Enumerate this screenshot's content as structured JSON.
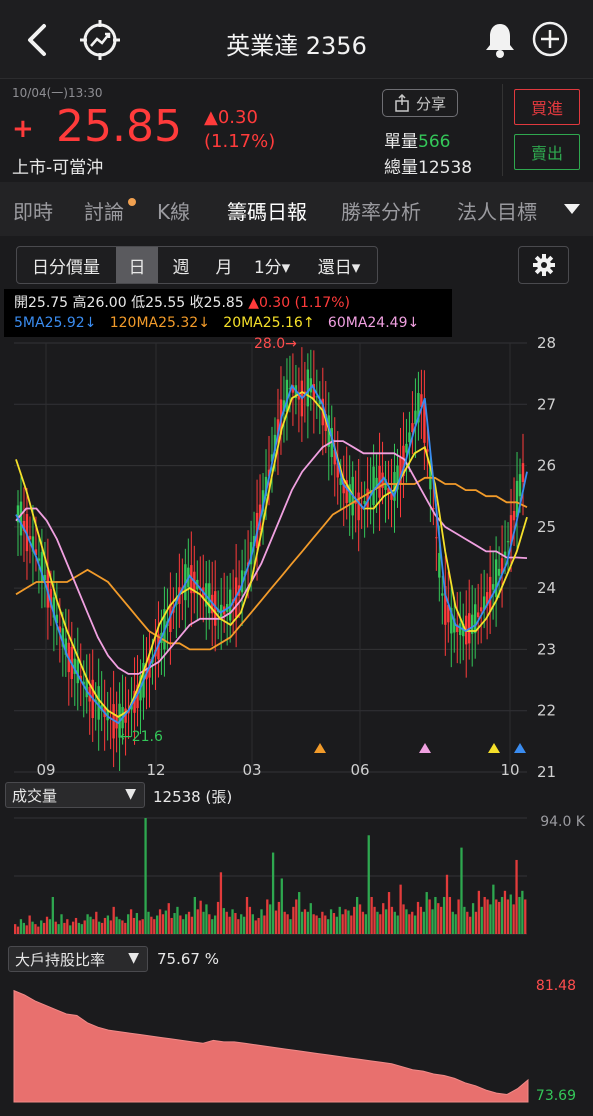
{
  "header": {
    "title": "英業達 2356",
    "back_icon": "chevron-left-icon",
    "logo_icon": "trend-target-icon",
    "bell_icon": "bell-icon",
    "add_icon": "plus-circle-icon"
  },
  "quote": {
    "datetime": "10/04(一)13:30",
    "sign": "+",
    "price": "25.85",
    "change": "▲0.30",
    "change_pct": "(1.17%)",
    "market": "上市-可當沖",
    "share_label": "分享",
    "unit_volume_label": "單量",
    "unit_volume": "566",
    "total_volume_label": "總量",
    "total_volume": "12538",
    "buy_label": "買進",
    "sell_label": "賣出",
    "up_color": "#ff3b3b",
    "down_color": "#34c759"
  },
  "tabs": [
    {
      "label": "即時"
    },
    {
      "label": "討論"
    },
    {
      "label": "K線"
    },
    {
      "label": "籌碼日報"
    },
    {
      "label": "勝率分析"
    },
    {
      "label": "法人目標"
    }
  ],
  "selector": {
    "items": [
      "日分價量",
      "日",
      "週",
      "月",
      "1分▾",
      "還日▾"
    ],
    "selected_index": 1
  },
  "info": {
    "open_label": "開",
    "open": "25.75",
    "high_label": "高",
    "high": "26.00",
    "low_label": "低",
    "low": "25.55",
    "close_label": "收",
    "close": "25.85",
    "change": "▲0.30 (1.17%)",
    "ma5": "5MA25.92↓",
    "ma120": "120MA25.32↓",
    "ma20": "20MA25.16↑",
    "ma60": "60MA24.49↓",
    "ma5_color": "#3a8cf0",
    "ma120_color": "#f29b2a",
    "ma20_color": "#f5e02a",
    "ma60_color": "#f0a0e0"
  },
  "chart_data": [
    {
      "type": "line",
      "title": "",
      "ylim": [
        21,
        28
      ],
      "y_ticks": [
        "28",
        "27",
        "26",
        "25",
        "24",
        "23",
        "22",
        "21"
      ],
      "x_ticks": [
        "09",
        "12",
        "03",
        "06",
        "10"
      ],
      "annotations": {
        "high": "28.0→",
        "low": "←21.6"
      },
      "series": [
        {
          "name": "5MA",
          "color": "#3a8cf0",
          "values": [
            25.2,
            24.9,
            24.5,
            24.0,
            23.4,
            22.9,
            22.6,
            22.3,
            22.1,
            21.9,
            21.8,
            22.0,
            22.3,
            22.7,
            23.1,
            23.5,
            23.9,
            24.2,
            24.0,
            23.8,
            23.6,
            23.7,
            24.0,
            24.5,
            25.2,
            26.0,
            26.8,
            27.3,
            27.1,
            27.3,
            27.0,
            26.4,
            25.7,
            25.5,
            25.3,
            25.6,
            25.8,
            25.5,
            26.0,
            26.6,
            27.1,
            25.5,
            23.9,
            23.4,
            23.3,
            23.4,
            23.7,
            24.0,
            24.4,
            25.1,
            25.9
          ]
        },
        {
          "name": "20MA",
          "color": "#f5e02a",
          "values": [
            26.1,
            25.6,
            25.0,
            24.4,
            23.8,
            23.3,
            22.9,
            22.5,
            22.2,
            22.0,
            21.9,
            22.0,
            22.4,
            22.9,
            23.4,
            23.7,
            23.9,
            24.0,
            23.9,
            23.7,
            23.5,
            23.4,
            23.6,
            24.1,
            24.9,
            25.8,
            26.6,
            27.1,
            27.2,
            27.1,
            26.9,
            26.4,
            25.8,
            25.5,
            25.3,
            25.3,
            25.5,
            25.6,
            25.9,
            26.2,
            26.3,
            25.7,
            24.6,
            23.7,
            23.3,
            23.3,
            23.5,
            23.8,
            24.2,
            24.6,
            25.16
          ]
        },
        {
          "name": "60MA",
          "color": "#f0a0e0",
          "values": [
            25.1,
            25.3,
            25.3,
            25.1,
            24.8,
            24.4,
            24.0,
            23.6,
            23.2,
            22.9,
            22.7,
            22.6,
            22.6,
            22.7,
            22.8,
            23.0,
            23.2,
            23.4,
            23.5,
            23.5,
            23.5,
            23.6,
            23.8,
            24.1,
            24.4,
            24.8,
            25.2,
            25.6,
            25.9,
            26.1,
            26.3,
            26.4,
            26.4,
            26.3,
            26.2,
            26.2,
            26.2,
            26.2,
            26.1,
            25.8,
            25.5,
            25.2,
            25.0,
            24.9,
            24.8,
            24.7,
            24.6,
            24.6,
            24.5,
            24.5,
            24.49
          ]
        },
        {
          "name": "120MA",
          "color": "#f29b2a",
          "values": [
            23.9,
            24.0,
            24.1,
            24.1,
            24.1,
            24.1,
            24.2,
            24.3,
            24.2,
            24.1,
            23.9,
            23.7,
            23.5,
            23.3,
            23.2,
            23.1,
            23.1,
            23.0,
            23.0,
            23.0,
            23.1,
            23.2,
            23.4,
            23.6,
            23.8,
            24.0,
            24.2,
            24.4,
            24.6,
            24.8,
            25.0,
            25.2,
            25.3,
            25.4,
            25.5,
            25.6,
            25.7,
            25.7,
            25.7,
            25.7,
            25.8,
            25.8,
            25.7,
            25.7,
            25.6,
            25.6,
            25.5,
            25.5,
            25.4,
            25.4,
            25.32
          ]
        }
      ]
    },
    {
      "type": "bar",
      "title": "成交量",
      "ymax_label": "94.0 K",
      "values": [
        8,
        6,
        12,
        9,
        7,
        15,
        10,
        8,
        6,
        11,
        9,
        14,
        12,
        30,
        10,
        8,
        16,
        9,
        12,
        7,
        10,
        13,
        9,
        8,
        11,
        16,
        14,
        12,
        18,
        10,
        9,
        13,
        15,
        11,
        22,
        14,
        12,
        11,
        9,
        16,
        20,
        13,
        17,
        11,
        12,
        94,
        18,
        14,
        12,
        15,
        20,
        16,
        19,
        25,
        13,
        17,
        22,
        15,
        12,
        16,
        18,
        14,
        30,
        20,
        27,
        18,
        24,
        16,
        12,
        15,
        26,
        50,
        21,
        18,
        14,
        20,
        17,
        12,
        16,
        14,
        30,
        22,
        16,
        11,
        13,
        20,
        15,
        28,
        24,
        66,
        19,
        26,
        45,
        18,
        16,
        12,
        22,
        28,
        34,
        18,
        20,
        18,
        25,
        16,
        15,
        13,
        18,
        15,
        12,
        20,
        17,
        14,
        22,
        16,
        20,
        19,
        15,
        22,
        30,
        24,
        18,
        16,
        80,
        30,
        22,
        18,
        16,
        25,
        20,
        34,
        22,
        18,
        15,
        40,
        24,
        20,
        16,
        18,
        15,
        26,
        22,
        18,
        34,
        28,
        20,
        30,
        25,
        22,
        30,
        48,
        30,
        18,
        16,
        28,
        70,
        22,
        18,
        14,
        25,
        18,
        35,
        22,
        30,
        28,
        24,
        40,
        28,
        26,
        30,
        35,
        28,
        32,
        24,
        60,
        30,
        35,
        28
      ]
    },
    {
      "type": "area",
      "title": "大戶持股比率",
      "current": "75.67 %",
      "ymax_label": "81.48",
      "ymin_label": "73.69",
      "ylim": [
        73.69,
        81.48
      ],
      "values": [
        81.3,
        81.0,
        80.6,
        80.3,
        80.0,
        79.7,
        79.6,
        79.1,
        78.8,
        78.6,
        78.5,
        78.4,
        78.3,
        78.2,
        78.1,
        78.0,
        77.9,
        77.8,
        77.7,
        77.9,
        77.8,
        77.8,
        77.7,
        77.6,
        77.5,
        77.4,
        77.3,
        77.2,
        77.1,
        77.0,
        76.9,
        76.8,
        76.7,
        76.6,
        76.5,
        76.4,
        76.3,
        76.1,
        75.9,
        75.8,
        75.6,
        75.5,
        75.3,
        75.0,
        74.8,
        74.5,
        74.3,
        74.2,
        74.6,
        75.2
      ]
    }
  ]
}
